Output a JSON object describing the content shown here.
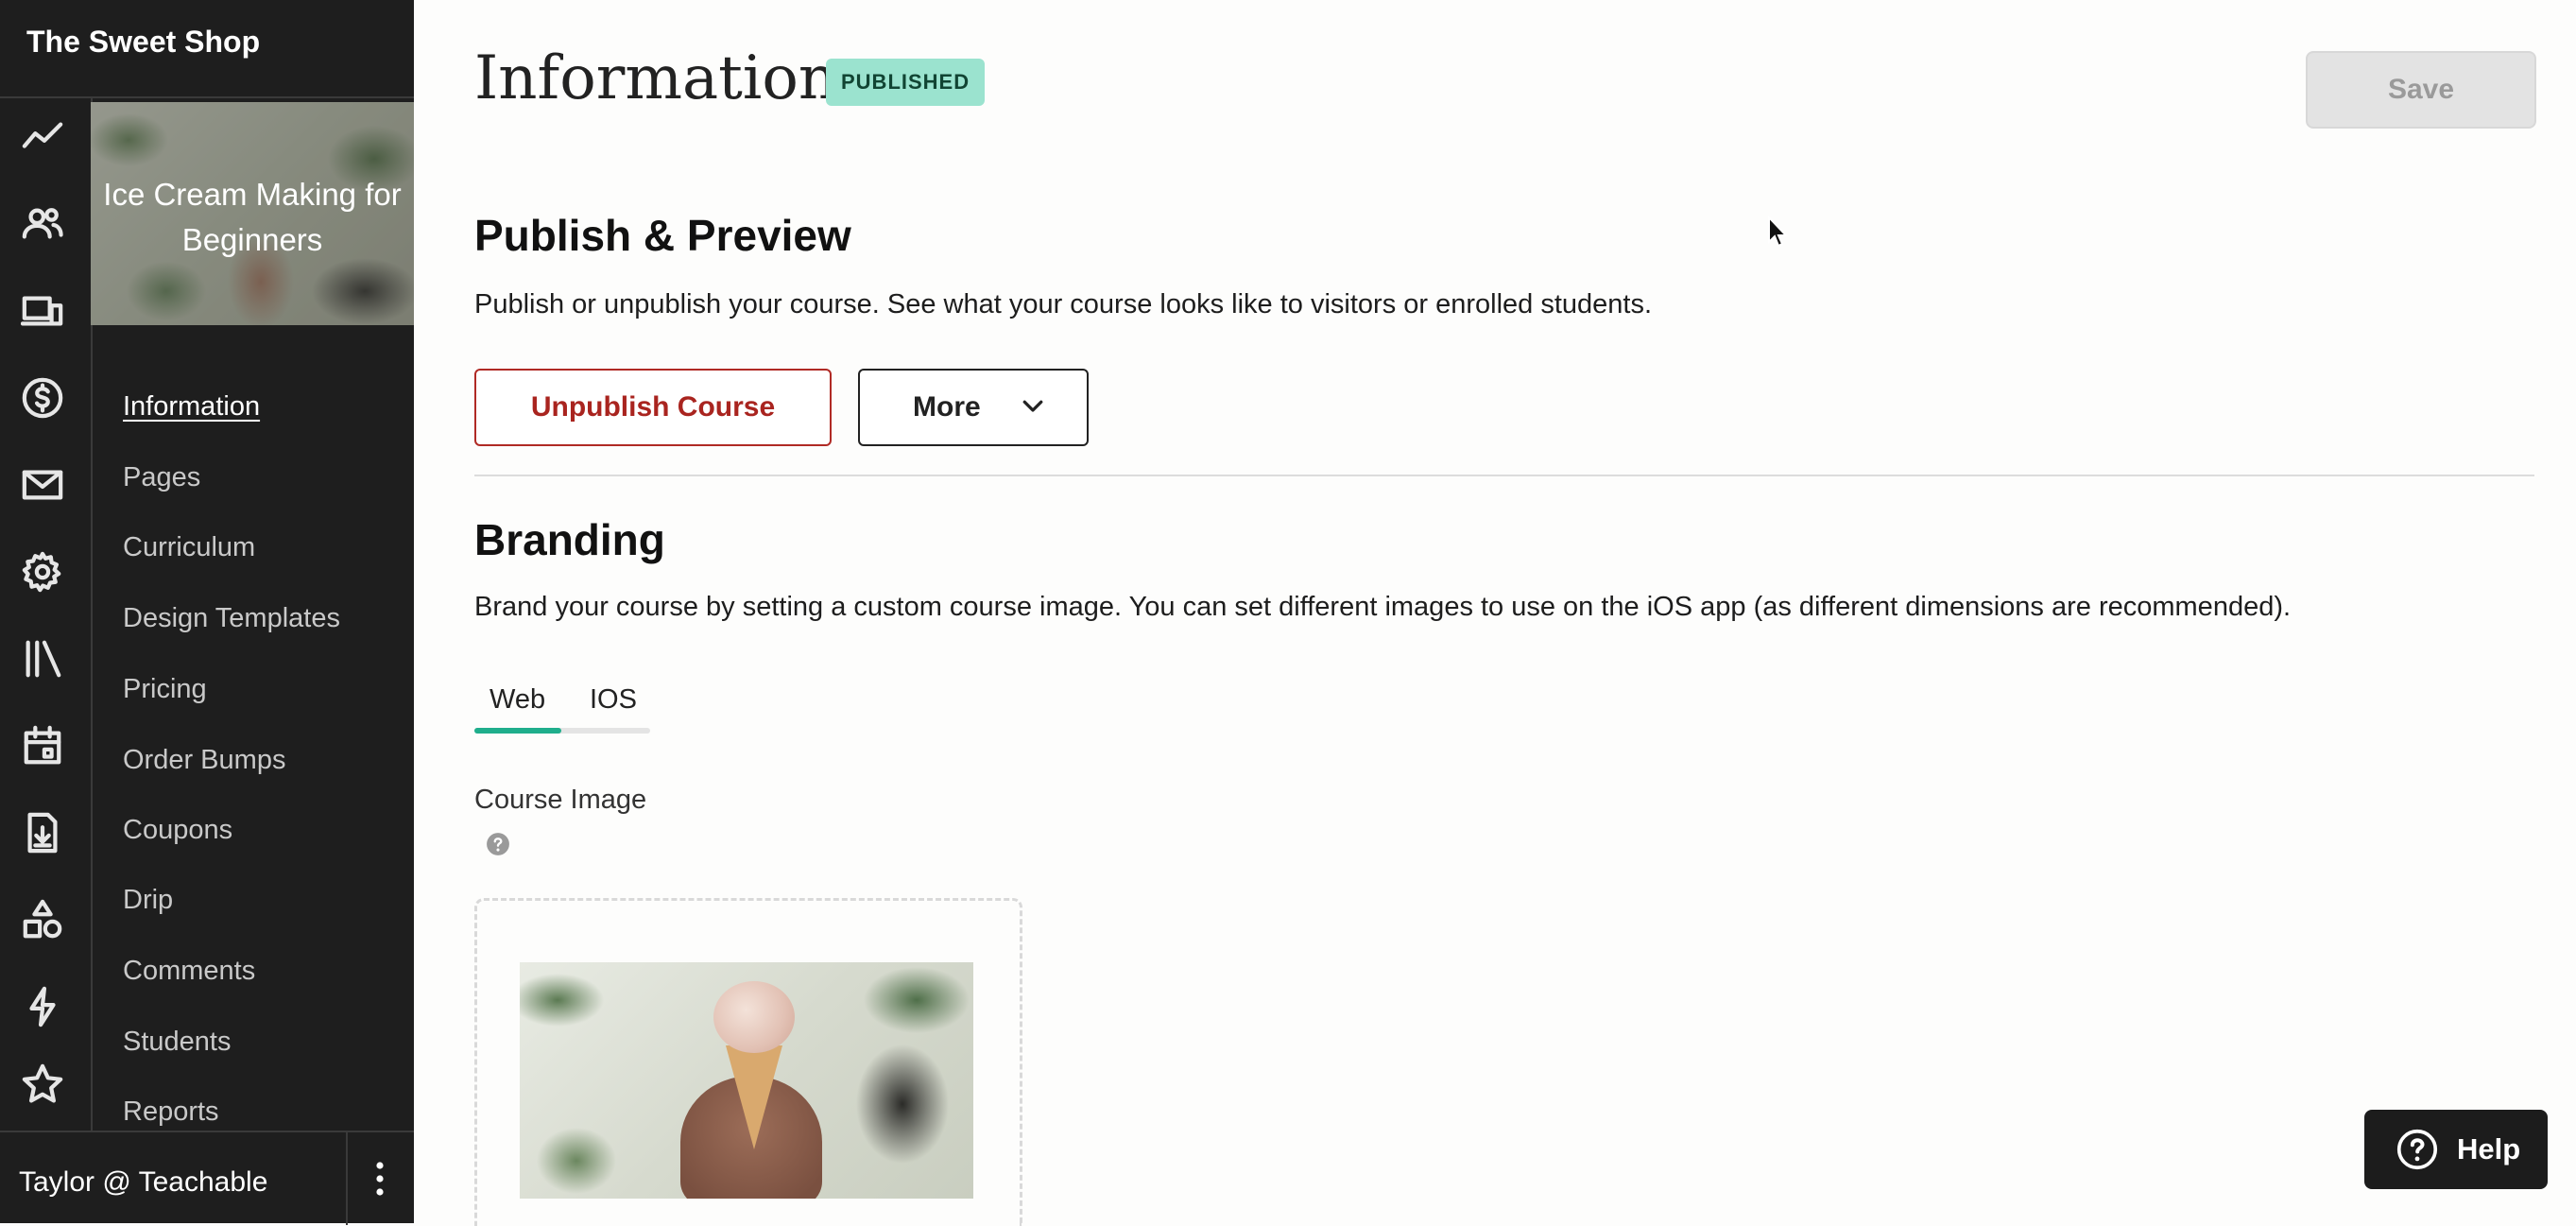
{
  "sidebar": {
    "school_name": "The Sweet Shop",
    "course_card_title": "Ice Cream Making for Beginners",
    "rail_icons": [
      "analytics-icon",
      "users-icon",
      "devices-icon",
      "dollar-icon",
      "mail-icon",
      "gear-icon",
      "library-icon",
      "calendar-icon",
      "download-doc-icon",
      "shapes-icon",
      "lightning-icon",
      "star-icon"
    ],
    "nav": [
      {
        "label": "Information",
        "active": true
      },
      {
        "label": "Pages"
      },
      {
        "label": "Curriculum"
      },
      {
        "label": "Design Templates"
      },
      {
        "label": "Pricing"
      },
      {
        "label": "Order Bumps"
      },
      {
        "label": "Coupons"
      },
      {
        "label": "Drip"
      },
      {
        "label": "Comments"
      },
      {
        "label": "Students"
      },
      {
        "label": "Reports"
      }
    ],
    "user": "Taylor @ Teachable"
  },
  "header": {
    "title": "Information",
    "status": "PUBLISHED",
    "save_label": "Save"
  },
  "publish": {
    "heading": "Publish & Preview",
    "description": "Publish or unpublish your course. See what your course looks like to visitors or enrolled students.",
    "unpublish_label": "Unpublish Course",
    "more_label": "More"
  },
  "branding": {
    "heading": "Branding",
    "description": "Brand your course by setting a custom course image. You can set different images to use on the iOS app (as different dimensions are recommended).",
    "tabs": [
      "Web",
      "IOS"
    ],
    "active_tab": "Web",
    "course_image_label": "Course Image"
  },
  "help_label": "Help",
  "colors": {
    "sidebar_bg": "#1e1e1e",
    "badge_bg": "#9be3cf",
    "unpublish": "#a9241f",
    "tab_indicator": "#1fae8c"
  }
}
